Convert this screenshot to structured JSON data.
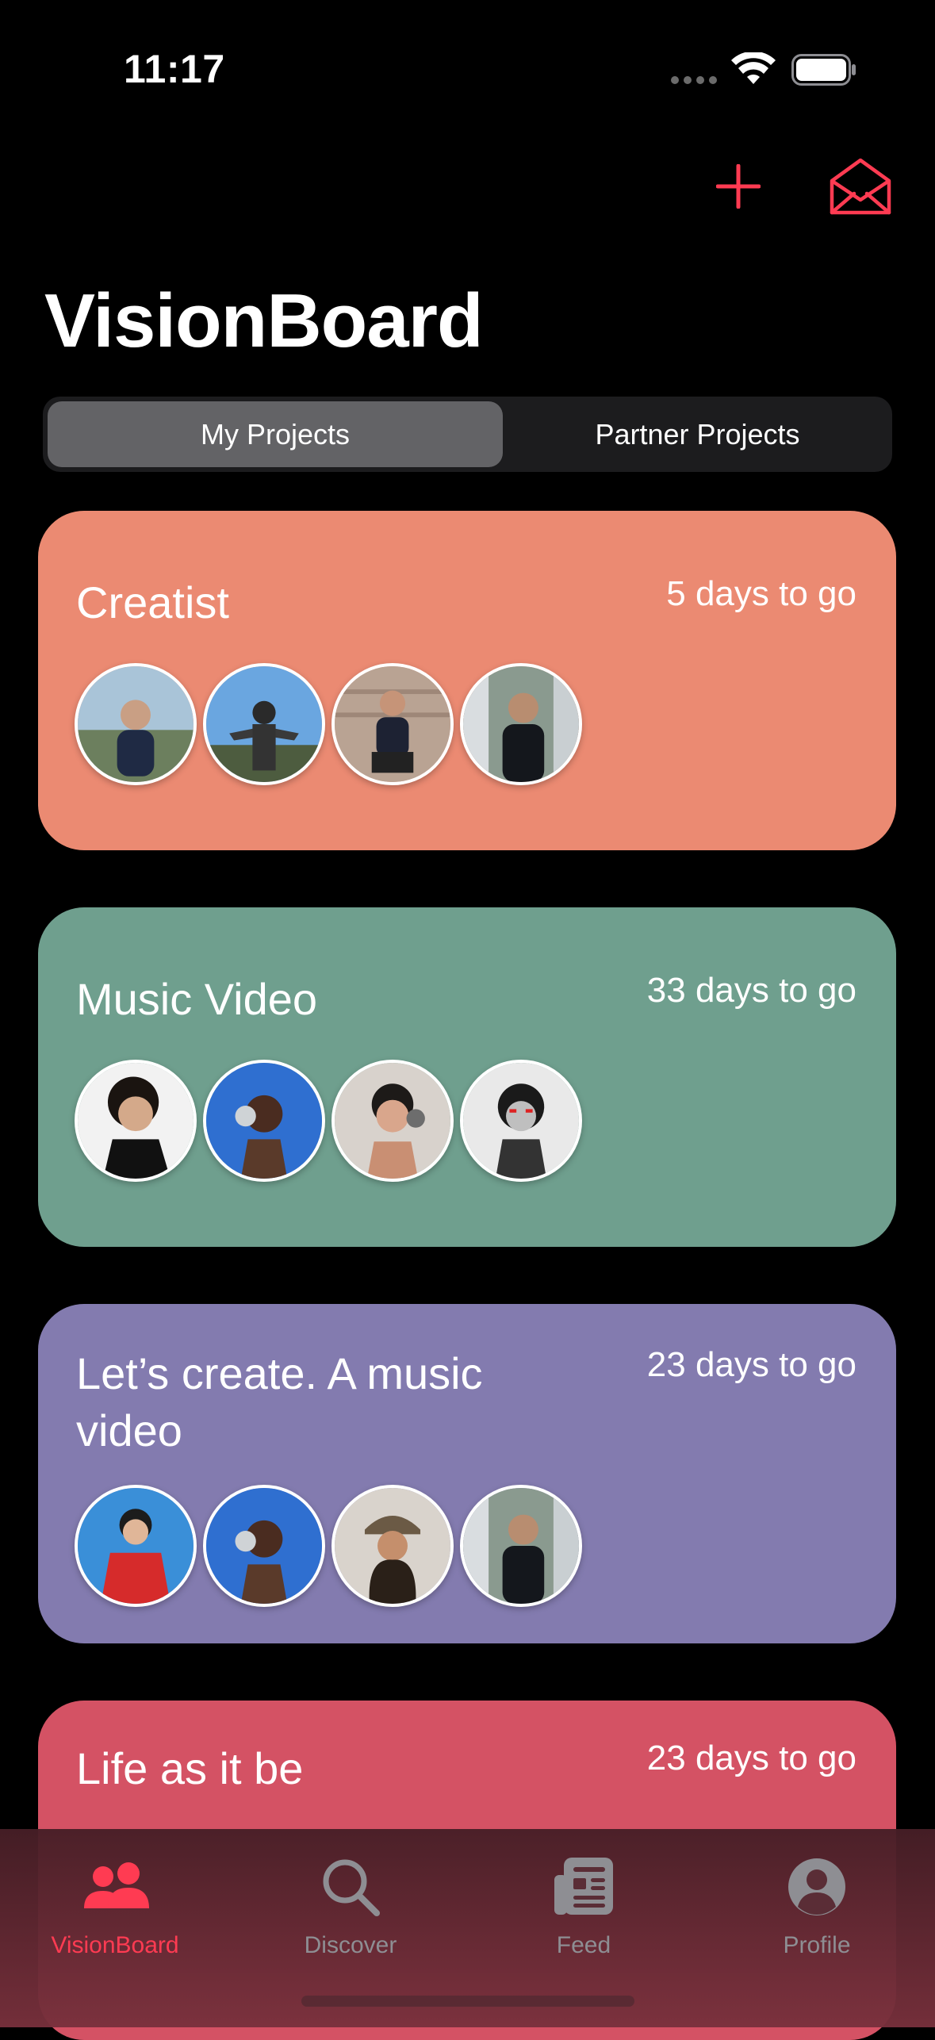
{
  "status": {
    "time": "11:17"
  },
  "header": {
    "title": "VisionBoard"
  },
  "segments": {
    "active": "My Projects",
    "inactive": "Partner Projects"
  },
  "cards": [
    {
      "title": "Creatist",
      "days": "5 days to go",
      "color": "#eb8a72"
    },
    {
      "title": "Music Video",
      "days": "33 days to go",
      "color": "#6f9f8e"
    },
    {
      "title": "Let’s create. A music video",
      "days": "23 days to go",
      "color": "#837baf"
    },
    {
      "title": "Life as it be",
      "days": "23 days to go",
      "color": "#d45264"
    }
  ],
  "tabs": [
    {
      "label": "VisionBoard",
      "icon": "people-icon",
      "active": true
    },
    {
      "label": "Discover",
      "icon": "search-icon",
      "active": false
    },
    {
      "label": "Feed",
      "icon": "newspaper-icon",
      "active": false
    },
    {
      "label": "Profile",
      "icon": "person-circle-icon",
      "active": false
    }
  ],
  "colors": {
    "accent": "#ff3b52",
    "inactive_tab": "#8e8e93"
  }
}
